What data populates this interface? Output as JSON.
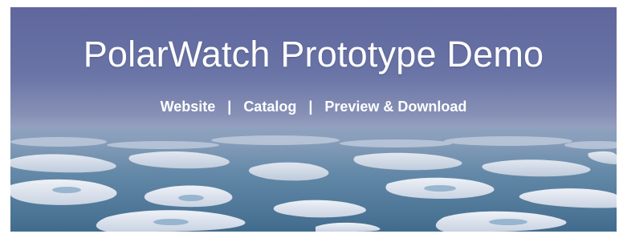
{
  "banner": {
    "title": "PolarWatch Prototype Demo",
    "links": [
      {
        "label": "Website"
      },
      {
        "label": "Catalog"
      },
      {
        "label": "Preview & Download"
      }
    ],
    "separator": "|"
  },
  "colors": {
    "sky_top": "#5f679d",
    "haze": "#a6b2cb",
    "water": "#4f7595",
    "ice": "#dfe4ef",
    "text": "#ffffff"
  }
}
